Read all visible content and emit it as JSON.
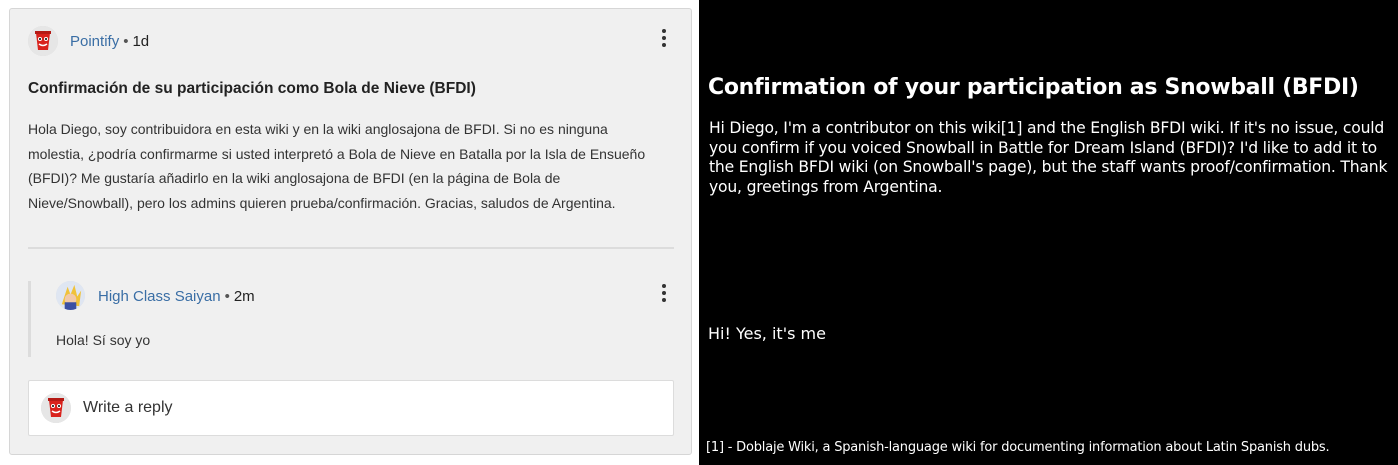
{
  "post": {
    "author": "Pointify",
    "age": "1d",
    "separator": "•",
    "title": "Confirmación de su participación como Bola de Nieve (BFDI)",
    "body": "Hola Diego, soy contribuidora en esta wiki y en la wiki anglosajona de BFDI. Si no es ninguna molestia, ¿podría confirmarme si usted interpretó a Bola de Nieve en Batalla por la Isla de Ensueño (BFDI)? Me gustaría añadirlo en la wiki anglosajona de BFDI (en la página de Bola de Nieve/Snowball), pero los admins quieren prueba/confirmación. Gracias, saludos de Argentina.",
    "menu_icon": "more-vertical-icon"
  },
  "reply": {
    "author": "High Class Saiyan",
    "age": "2m",
    "separator": "•",
    "text": "Hola! Sí soy yo",
    "menu_icon": "more-vertical-icon"
  },
  "composer": {
    "placeholder": "Write a reply"
  },
  "translation": {
    "title": "Confirmation of your participation as Snowball (BFDI)",
    "body": "Hi Diego, I'm a contributor on this wiki[1] and the English BFDI wiki. If it's no issue, could you confirm if you voiced Snowball in Battle for Dream Island (BFDI)? I'd like to add it to the English BFDI wiki (on Snowball's page), but the staff wants proof/confirmation. Thank you, greetings from Argentina.",
    "reply": "Hi! Yes, it's me",
    "footnote": "[1] - Doblaje Wiki, a Spanish-language wiki for documenting information about Latin Spanish dubs."
  },
  "colors": {
    "username": "#3a6ea5",
    "card_background": "#f0f0f0",
    "panel_background": "#000000"
  }
}
